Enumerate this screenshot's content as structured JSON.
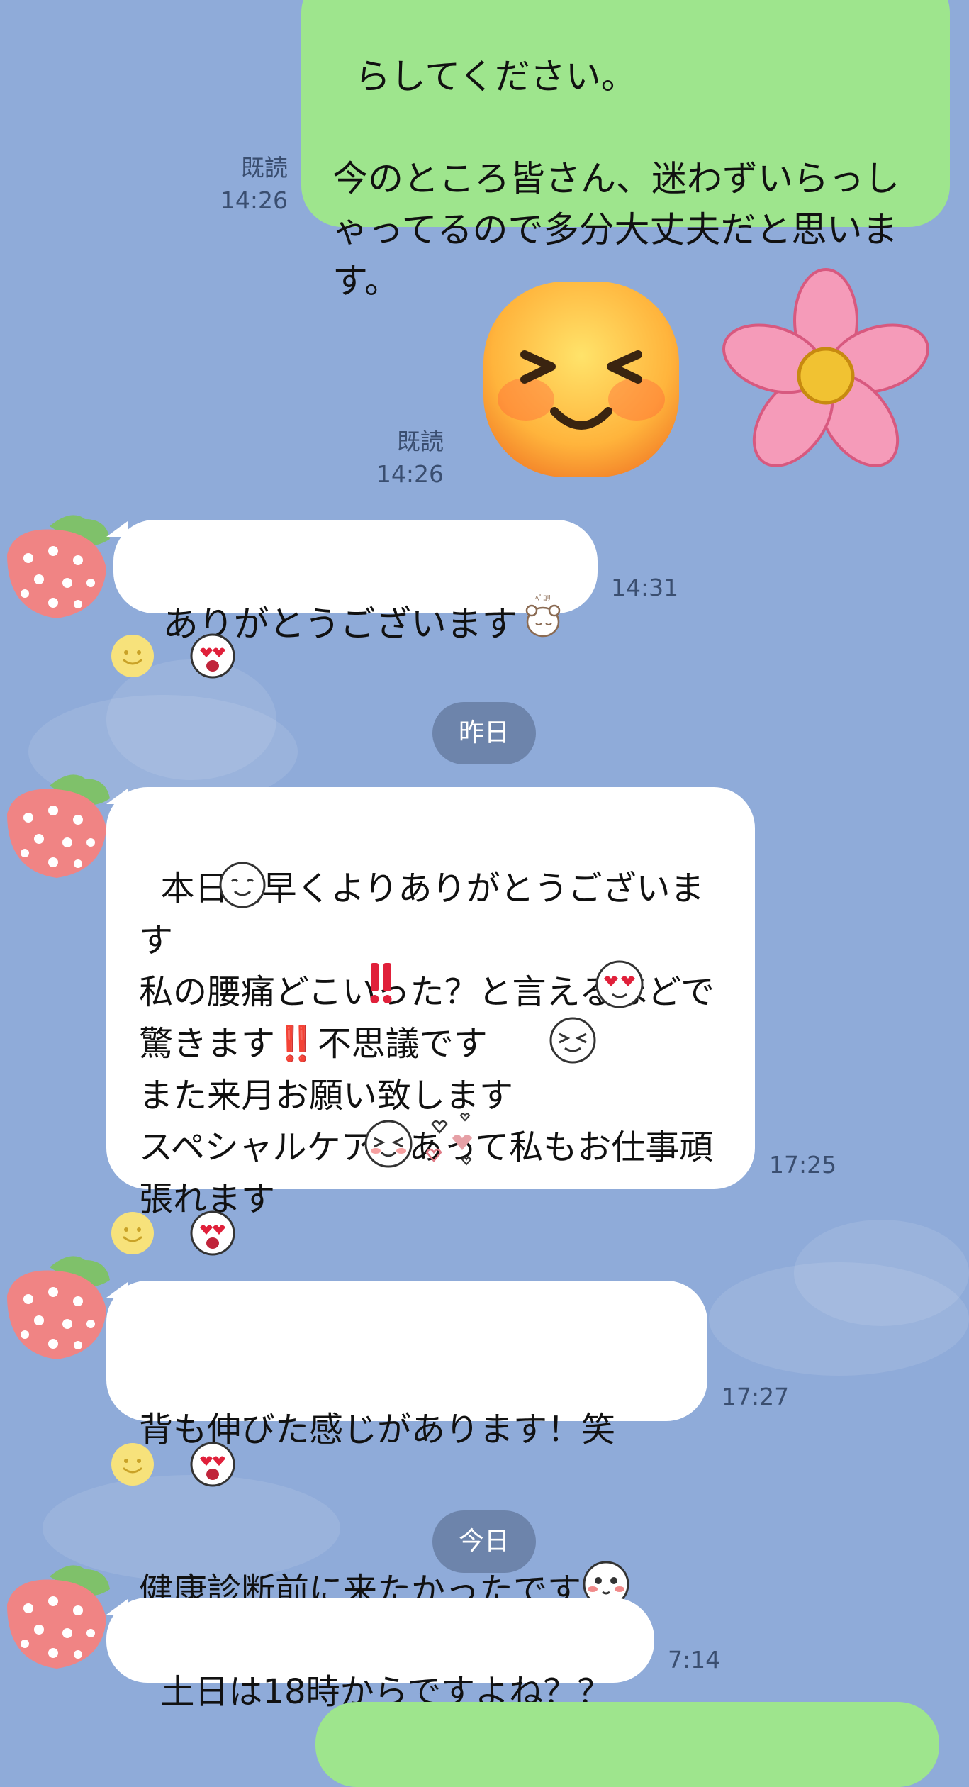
{
  "colors": {
    "background": "#8fabd9",
    "outgoing_bubble": "#9ee58d",
    "incoming_bubble": "#ffffff",
    "date_pill": "#6d84ab",
    "meta_text": "#3a4e70"
  },
  "messages": {
    "m1": {
      "text": "らしてください。\n\n今のところ皆さん、迷わずいらっしゃってるので多分大丈夫だと思います。",
      "read": "既読",
      "time": "14:26"
    },
    "m2": {
      "stickers": [
        "smiling-face-sticker",
        "pink-flower-sticker"
      ],
      "read": "既読",
      "time": "14:26"
    },
    "m3": {
      "text": "ありがとうございます",
      "emoji": "bowing-bear-emoji",
      "time": "14:31",
      "reactions": [
        "smile-reaction",
        "heart-eyes-reaction"
      ]
    },
    "m4": {
      "text": "本日朝早くよりありがとうございます\n私の腰痛どこいった？と言えるほどで驚きます‼️不思議です\nまた来月お願い致します\nスペシャルケアがあって私もお仕事頑張れます",
      "emojis": [
        "happy-face-emoji",
        "double-exclamation-emoji",
        "heart-eyes-emoji",
        "squint-face-emoji",
        "laughing-face-emoji",
        "hearts-emoji"
      ],
      "time": "17:25",
      "reactions": [
        "smile-reaction",
        "heart-eyes-reaction"
      ]
    },
    "m5": {
      "line1": "背も伸びた感じがあります！笑",
      "line2": "健康診断前に来たかったです",
      "emoji": "blushing-face-emoji",
      "time": "17:27",
      "reactions": [
        "smile-reaction",
        "heart-eyes-reaction"
      ]
    },
    "m6": {
      "text": "土日は18時からですよね？？",
      "time": "7:14"
    }
  },
  "date_separators": {
    "yesterday": "昨日",
    "today": "今日"
  },
  "avatar": {
    "icon": "strawberry-avatar-icon"
  }
}
